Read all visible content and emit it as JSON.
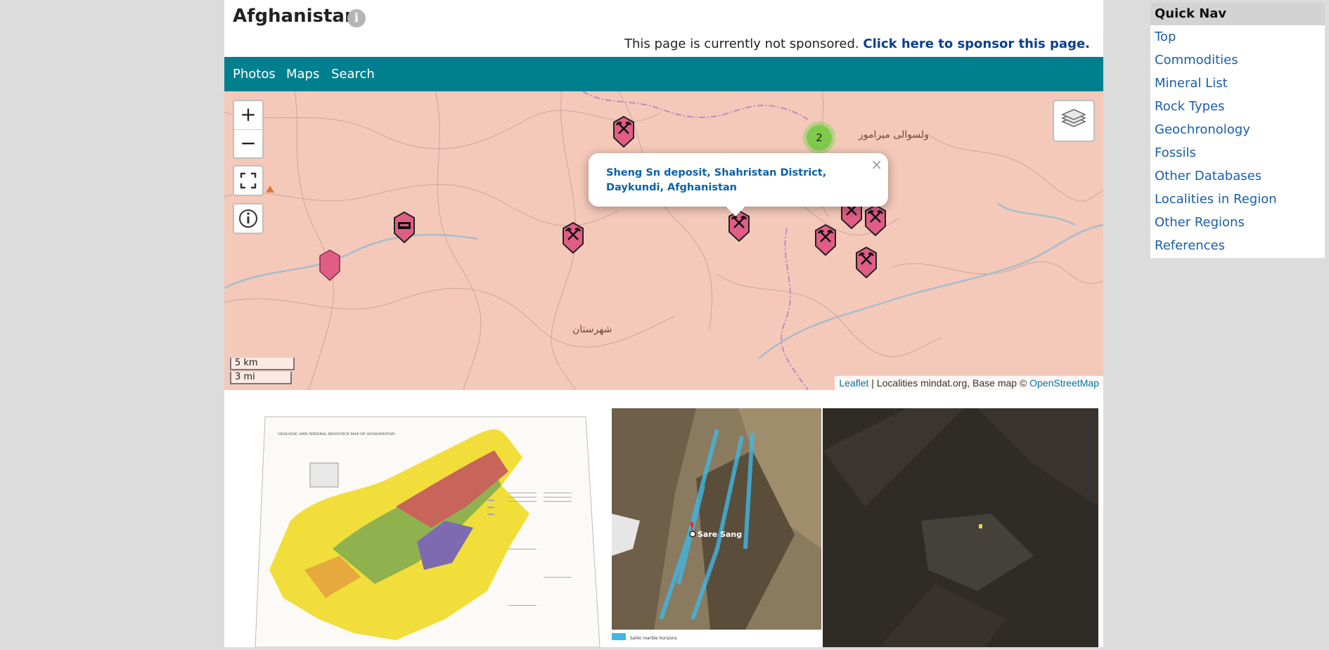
{
  "page": {
    "title": "Afghanistan",
    "info_icon": "info-icon"
  },
  "sponsor": {
    "text": "This page is currently not sponsored.",
    "link": "Click here to sponsor this page."
  },
  "tabs": [
    "Photos",
    "Maps",
    "Search"
  ],
  "map": {
    "zoom_in": "+",
    "zoom_out": "−",
    "cluster_count": "2",
    "popup_text": "Sheng Sn deposit, Shahristan District, Daykundi, Afghanistan",
    "popup_close": "×",
    "label_1": "ولسوالی میرامور",
    "label_2": "شهرستان",
    "scale_km": "5 km",
    "scale_mi": "3 mi",
    "attribution": {
      "leaflet": "Leaflet",
      "middle": " | Localities mindat.org, Base map © ",
      "osm": "OpenStreetMap"
    }
  },
  "gallery": {
    "map_title": "GEOLOGIC AND MINERAL RESOURCE MAP OF AFGHANISTAN",
    "satellite_label": "Sare Sang",
    "legend_text": "Sahki marble horizons"
  },
  "sidebar": {
    "title": "Quick Nav",
    "items": [
      "Top",
      "Commodities",
      "Mineral List",
      "Rock Types",
      "Geochronology",
      "Fossils",
      "Other Databases",
      "Localities in Region",
      "Other Regions",
      "References"
    ]
  },
  "colors": {
    "tabbar": "#00808f",
    "map_bg": "#f4c9b9",
    "link": "#1a5ea8",
    "marker": "#e05e86"
  }
}
